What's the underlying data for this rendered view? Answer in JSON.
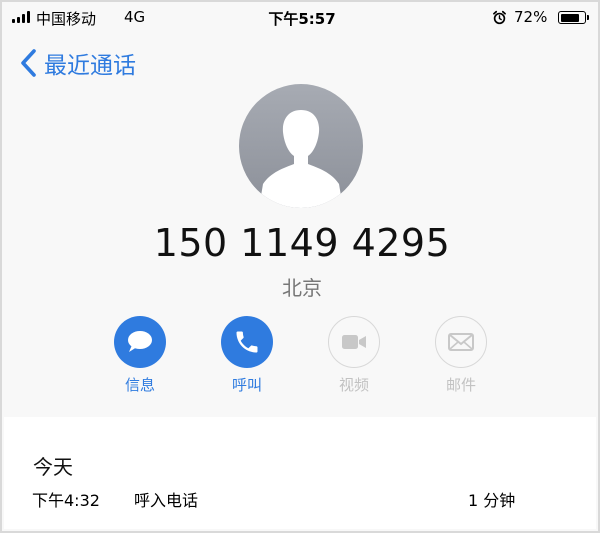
{
  "status_bar": {
    "carrier": "中国移动",
    "network": "4G",
    "time": "下午5:57",
    "battery": "72%",
    "battery_level": 0.72,
    "alarm_icon": "alarm-clock-icon"
  },
  "nav": {
    "back_label": "最近通话",
    "back_icon": "chevron-left-icon"
  },
  "contact": {
    "avatar_icon": "person-silhouette-icon",
    "phone_number": "150 1149 4295",
    "location": "北京"
  },
  "actions": [
    {
      "label": "信息",
      "icon": "message-bubble-icon",
      "enabled": true
    },
    {
      "label": "呼叫",
      "icon": "phone-icon",
      "enabled": true
    },
    {
      "label": "视频",
      "icon": "video-camera-icon",
      "enabled": false
    },
    {
      "label": "邮件",
      "icon": "envelope-icon",
      "enabled": false
    }
  ],
  "recents": {
    "date": "今天",
    "calls": [
      {
        "time": "下午4:32",
        "type": "呼入电话",
        "duration": "1 分钟"
      }
    ]
  },
  "colors": {
    "accent": "#2f7bdf",
    "disabled": "#c2c2c2",
    "secondary_text": "#777777",
    "background": "#f8f8f8"
  }
}
